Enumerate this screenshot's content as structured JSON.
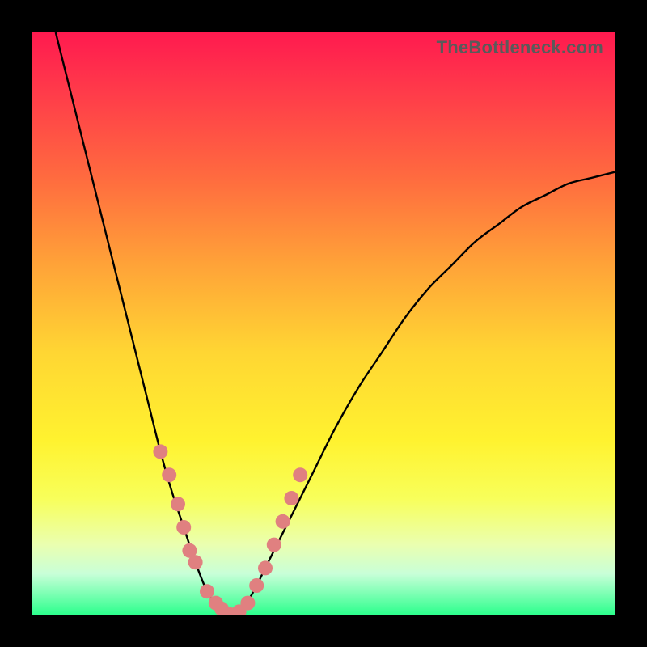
{
  "watermark": "TheBottleneck.com",
  "colors": {
    "curve_stroke": "#000000",
    "marker_fill": "#e08080",
    "gradient_top": "#ff1a4f",
    "gradient_bottom": "#2dff8d"
  },
  "chart_data": {
    "type": "line",
    "title": "",
    "xlabel": "",
    "ylabel": "",
    "xlim": [
      0,
      100
    ],
    "ylim": [
      0,
      100
    ],
    "grid": false,
    "series": [
      {
        "name": "bottleneck-curve",
        "x": [
          4,
          6,
          8,
          10,
          12,
          14,
          16,
          18,
          20,
          22,
          24,
          26,
          28,
          30,
          32,
          34,
          36,
          38,
          40,
          44,
          48,
          52,
          56,
          60,
          64,
          68,
          72,
          76,
          80,
          84,
          88,
          92,
          96,
          100
        ],
        "values": [
          100,
          92,
          84,
          76,
          68,
          60,
          52,
          44,
          36,
          28,
          21,
          15,
          9,
          4,
          1,
          0,
          1,
          4,
          8,
          16,
          24,
          32,
          39,
          45,
          51,
          56,
          60,
          64,
          67,
          70,
          72,
          74,
          75,
          76
        ]
      }
    ],
    "markers": {
      "name": "highlight-dots",
      "x": [
        22,
        23.5,
        25,
        26,
        27,
        28,
        30,
        31.5,
        32.5,
        34,
        35.5,
        37,
        38.5,
        40,
        41.5,
        43,
        44.5,
        46
      ],
      "values": [
        28,
        24,
        19,
        15,
        11,
        9,
        4,
        2,
        1,
        0,
        0.5,
        2,
        5,
        8,
        12,
        16,
        20,
        24
      ]
    }
  }
}
